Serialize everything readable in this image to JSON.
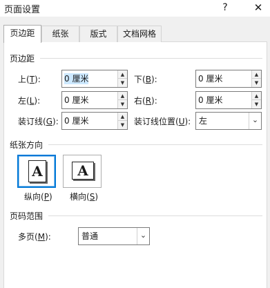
{
  "window": {
    "title": "页面设置",
    "help_label": "?",
    "close_label": "✕"
  },
  "tabs": [
    {
      "label": "页边距",
      "active": true
    },
    {
      "label": "纸张",
      "active": false
    },
    {
      "label": "版式",
      "active": false
    },
    {
      "label": "文档网格",
      "active": false
    }
  ],
  "margins": {
    "group_label": "页边距",
    "top": {
      "label": "上",
      "key": "T",
      "value": "0 厘米"
    },
    "bottom": {
      "label": "下",
      "key": "B",
      "value": "0 厘米"
    },
    "left": {
      "label": "左",
      "key": "L",
      "value": "0 厘米"
    },
    "right": {
      "label": "右",
      "key": "R",
      "value": "0 厘米"
    },
    "gutter": {
      "label": "装订线",
      "key": "G",
      "value": "0 厘米"
    },
    "gutter_position": {
      "label": "装订线位置",
      "key": "U",
      "value": "左"
    }
  },
  "orientation": {
    "group_label": "纸张方向",
    "glyph": "A",
    "portrait": {
      "label": "纵向",
      "key": "P",
      "selected": true
    },
    "landscape": {
      "label": "横向",
      "key": "S",
      "selected": false
    }
  },
  "pages": {
    "group_label": "页码范围",
    "multiple": {
      "label": "多页",
      "key": "M",
      "value": "普通"
    }
  },
  "icons": {
    "spin_up": "triangle-up",
    "spin_down": "triangle-down",
    "dropdown": "chevron-down"
  },
  "colors": {
    "accent": "#0078d7",
    "selection": "#cce8ff"
  }
}
